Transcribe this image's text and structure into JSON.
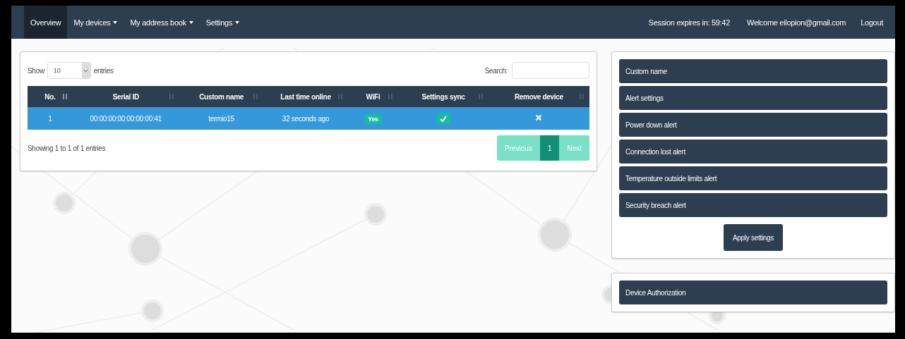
{
  "navbar": {
    "items": [
      {
        "label": "Overview",
        "selected": true,
        "dropdown": false
      },
      {
        "label": "My devices",
        "selected": false,
        "dropdown": true
      },
      {
        "label": "My address book",
        "selected": false,
        "dropdown": true
      },
      {
        "label": "Settings",
        "selected": false,
        "dropdown": true
      }
    ],
    "session": "Session expires in: 59:42",
    "welcome": "Welcome eilopion@gmail.com",
    "logout": "Logout"
  },
  "table": {
    "show_label": "Show",
    "page_size": "10",
    "entries_label": "entries",
    "search_label": "Search:",
    "columns": [
      {
        "label": "No.",
        "sorted": true
      },
      {
        "label": "Serial ID",
        "sorted": false
      },
      {
        "label": "Custom name",
        "sorted": false
      },
      {
        "label": "Last time online",
        "sorted": false
      },
      {
        "label": "WiFi",
        "sorted": false
      },
      {
        "label": "Settings sync",
        "sorted": false
      },
      {
        "label": "Remove device",
        "sorted": false
      }
    ],
    "rows": [
      {
        "selected": true,
        "no": "1",
        "serial_id": "00:00:00:00:00:00:00:41",
        "custom_name": "termio15",
        "last_online": "32 seconds ago",
        "wifi": "Yes",
        "settings_synced": true
      }
    ],
    "info": "Showing 1 to 1 of 1 entries",
    "pagination": {
      "previous": {
        "label": "Previous",
        "disabled": true
      },
      "pages": [
        {
          "label": "1",
          "selected": true
        }
      ],
      "next": {
        "label": "Next",
        "disabled": true
      }
    }
  },
  "settings_panel": {
    "items": [
      "Custom name",
      "Alert settings",
      "Power down alert",
      "Connection lost alert",
      "Temperature outside limits alert",
      "Security breach alert"
    ],
    "apply": "Apply settings"
  },
  "authorization_panel": {
    "items": [
      "Device Authorization"
    ]
  }
}
